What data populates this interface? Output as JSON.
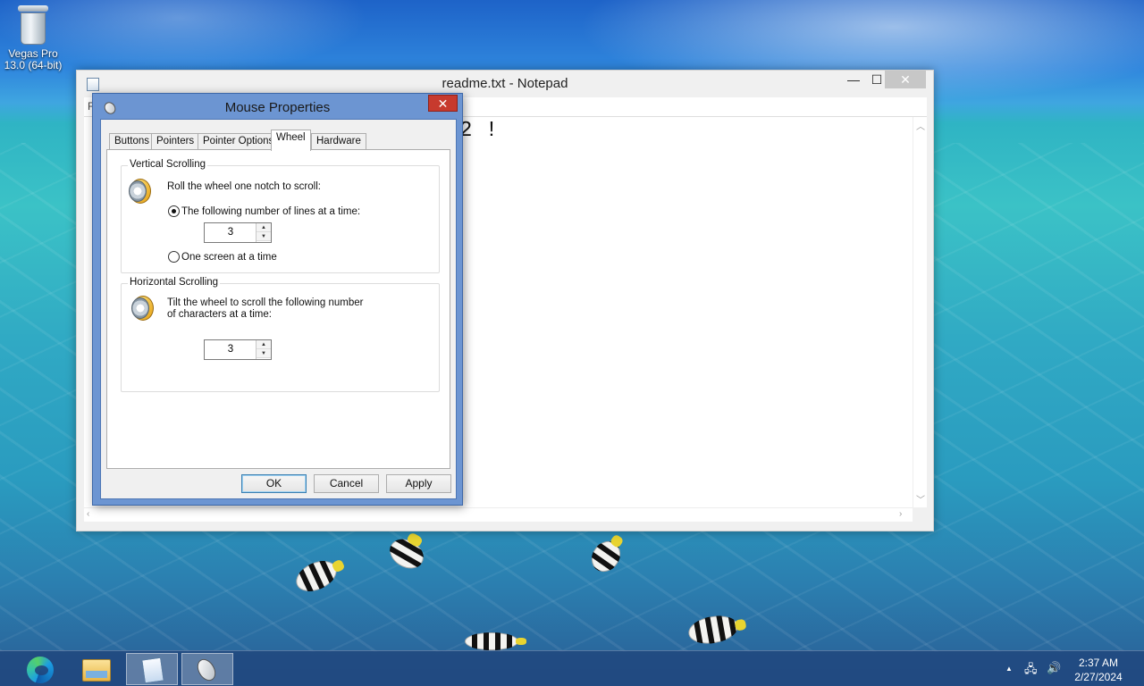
{
  "desktop": {
    "icons": [
      {
        "name": "recycle-bin",
        "label_line1": "Vegas Pro",
        "label_line2": "13.0 (64-bit)"
      }
    ]
  },
  "notepad": {
    "title": "readme.txt - Notepad",
    "menu_partial": "F",
    "text_visible": "2 !",
    "controls": {
      "minimize": "—",
      "maximize": "☐",
      "close": "✕"
    }
  },
  "dialog": {
    "title": "Mouse Properties",
    "close": "✕",
    "tabs": [
      {
        "label": "Buttons",
        "active": false
      },
      {
        "label": "Pointers",
        "active": false
      },
      {
        "label": "Pointer Options",
        "active": false
      },
      {
        "label": "Wheel",
        "active": true
      },
      {
        "label": "Hardware",
        "active": false
      }
    ],
    "vertical": {
      "group_title": "Vertical Scrolling",
      "instruction": "Roll the wheel one notch to scroll:",
      "option_lines": "The following number of lines at a time:",
      "option_lines_selected": true,
      "lines_value": "3",
      "option_screen": "One screen at a time",
      "option_screen_selected": false
    },
    "horizontal": {
      "group_title": "Horizontal Scrolling",
      "instruction_line1": "Tilt the wheel to scroll the following number",
      "instruction_line2": "of characters at a time:",
      "chars_value": "3"
    },
    "buttons": {
      "ok": "OK",
      "cancel": "Cancel",
      "apply": "Apply"
    },
    "spin_up": "▲",
    "spin_down": "▼"
  },
  "taskbar": {
    "apps": [
      "edge-icon",
      "file-explorer-icon",
      "notepad-icon",
      "mouse-properties-icon"
    ],
    "tray": {
      "overflow": "▲",
      "network": "🖧",
      "volume": "🔊"
    },
    "clock": {
      "time": "2:37 AM",
      "date": "2/27/2024"
    }
  },
  "colors": {
    "dialog_frame": "#6c95d2",
    "close_button": "#c73a2e",
    "taskbar": "#20467d"
  }
}
